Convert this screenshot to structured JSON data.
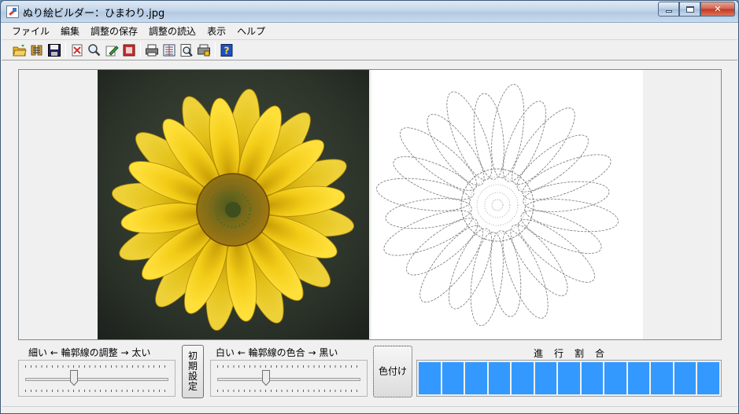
{
  "window": {
    "title": "ぬり絵ビルダー：ひまわり.jpg"
  },
  "menu": {
    "items": [
      "ファイル",
      "編集",
      "調整の保存",
      "調整の読込",
      "表示",
      "ヘルプ"
    ]
  },
  "toolbar": {
    "buttons": [
      {
        "icon": "open-folder-icon",
        "color": "#e8b420"
      },
      {
        "icon": "settings-chain-icon",
        "color": "#c09030"
      },
      {
        "icon": "save-disk-icon",
        "color": "#202060"
      },
      {
        "icon": "clear-icon",
        "color": "#d03030"
      },
      {
        "icon": "zoom-icon",
        "color": "#505050"
      },
      {
        "icon": "edit-pencil-icon",
        "color": "#40a040"
      },
      {
        "icon": "image-red-icon",
        "color": "#c83030"
      },
      {
        "icon": "print-icon",
        "color": "#404040"
      },
      {
        "icon": "print-setup-icon",
        "color": "#304060"
      },
      {
        "icon": "print-preview-icon",
        "color": "#505050"
      },
      {
        "icon": "printer-settings-icon",
        "color": "#404040"
      },
      {
        "icon": "help-icon",
        "color": "#2050c0"
      }
    ]
  },
  "outline_slider": {
    "label": "細い ← 輪郭線の調整 → 太い",
    "value_fraction": 0.33
  },
  "reset_button": {
    "label": "初期設定"
  },
  "color_slider": {
    "label": "白い ← 輪郭線の色合 → 黒い",
    "value_fraction": 0.33
  },
  "colorize_button": {
    "label": "色付け"
  },
  "progress": {
    "title": "進行割合",
    "value_fraction": 1.0,
    "blocks": 13,
    "color": "#3399ff"
  }
}
